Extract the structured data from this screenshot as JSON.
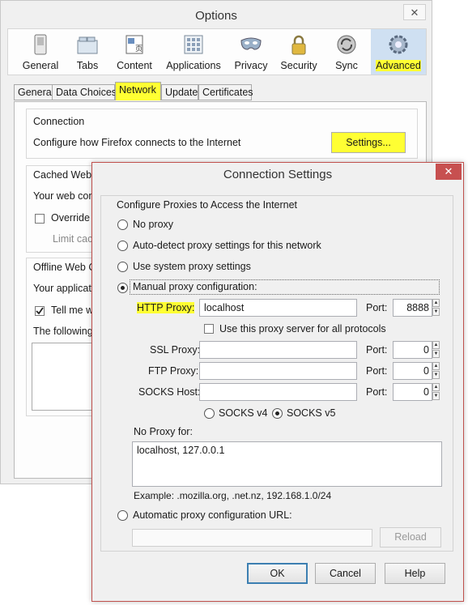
{
  "options": {
    "title": "Options",
    "close_glyph": "✕",
    "panes": [
      {
        "label": "General",
        "icon": "switch-icon"
      },
      {
        "label": "Tabs",
        "icon": "folder-tabs-icon"
      },
      {
        "label": "Content",
        "icon": "content-page-icon"
      },
      {
        "label": "Applications",
        "icon": "applications-icon"
      },
      {
        "label": "Privacy",
        "icon": "privacy-mask-icon"
      },
      {
        "label": "Security",
        "icon": "padlock-icon"
      },
      {
        "label": "Sync",
        "icon": "sync-icon"
      },
      {
        "label": "Advanced",
        "icon": "gear-icon"
      }
    ],
    "selected_pane": "Advanced",
    "tabs": [
      "General",
      "Data Choices",
      "Network",
      "Update",
      "Certificates"
    ],
    "selected_tab": "Network",
    "connection": {
      "heading": "Connection",
      "description": "Configure how Firefox connects to the Internet",
      "settings_button": "Settings..."
    },
    "cache": {
      "heading": "Cached Web C",
      "line1": "Your web con",
      "override": "Override a",
      "limit": "Limit cach"
    },
    "offline": {
      "heading": "Offline Web C",
      "line1": "Your applicati",
      "tell_me": "Tell me wh",
      "following": "The following"
    }
  },
  "dialog": {
    "title": "Connection Settings",
    "close_glyph": "✕",
    "group_label": "Configure Proxies to Access the Internet",
    "radios": {
      "no_proxy": "No proxy",
      "auto_detect": "Auto-detect proxy settings for this network",
      "system": "Use system proxy settings",
      "manual": "Manual proxy configuration:",
      "auto_url": "Automatic proxy configuration URL:"
    },
    "selected_mode": "manual",
    "http": {
      "label": "HTTP Proxy:",
      "value": "localhost",
      "port_label": "Port:",
      "port": "8888"
    },
    "use_for_all": {
      "label": "Use this proxy server for all protocols",
      "checked": false
    },
    "ssl": {
      "label": "SSL Proxy:",
      "value": "",
      "port_label": "Port:",
      "port": "0"
    },
    "ftp": {
      "label": "FTP Proxy:",
      "value": "",
      "port_label": "Port:",
      "port": "0"
    },
    "socks": {
      "label": "SOCKS Host:",
      "value": "",
      "port_label": "Port:",
      "port": "0"
    },
    "socks_v4": "SOCKS v4",
    "socks_v5": "SOCKS v5",
    "socks_selected": "v5",
    "no_proxy_for": {
      "label": "No Proxy for:",
      "value": "localhost, 127.0.0.1"
    },
    "example": "Example: .mozilla.org, .net.nz, 192.168.1.0/24",
    "auto_url_value": "",
    "reload_button": "Reload",
    "ok_button": "OK",
    "cancel_button": "Cancel",
    "help_button": "Help"
  },
  "colors": {
    "highlight": "#ffff33",
    "dialog_border": "#c0504d",
    "close_red": "#c75050",
    "selected_pane": "#cfe0f2"
  }
}
